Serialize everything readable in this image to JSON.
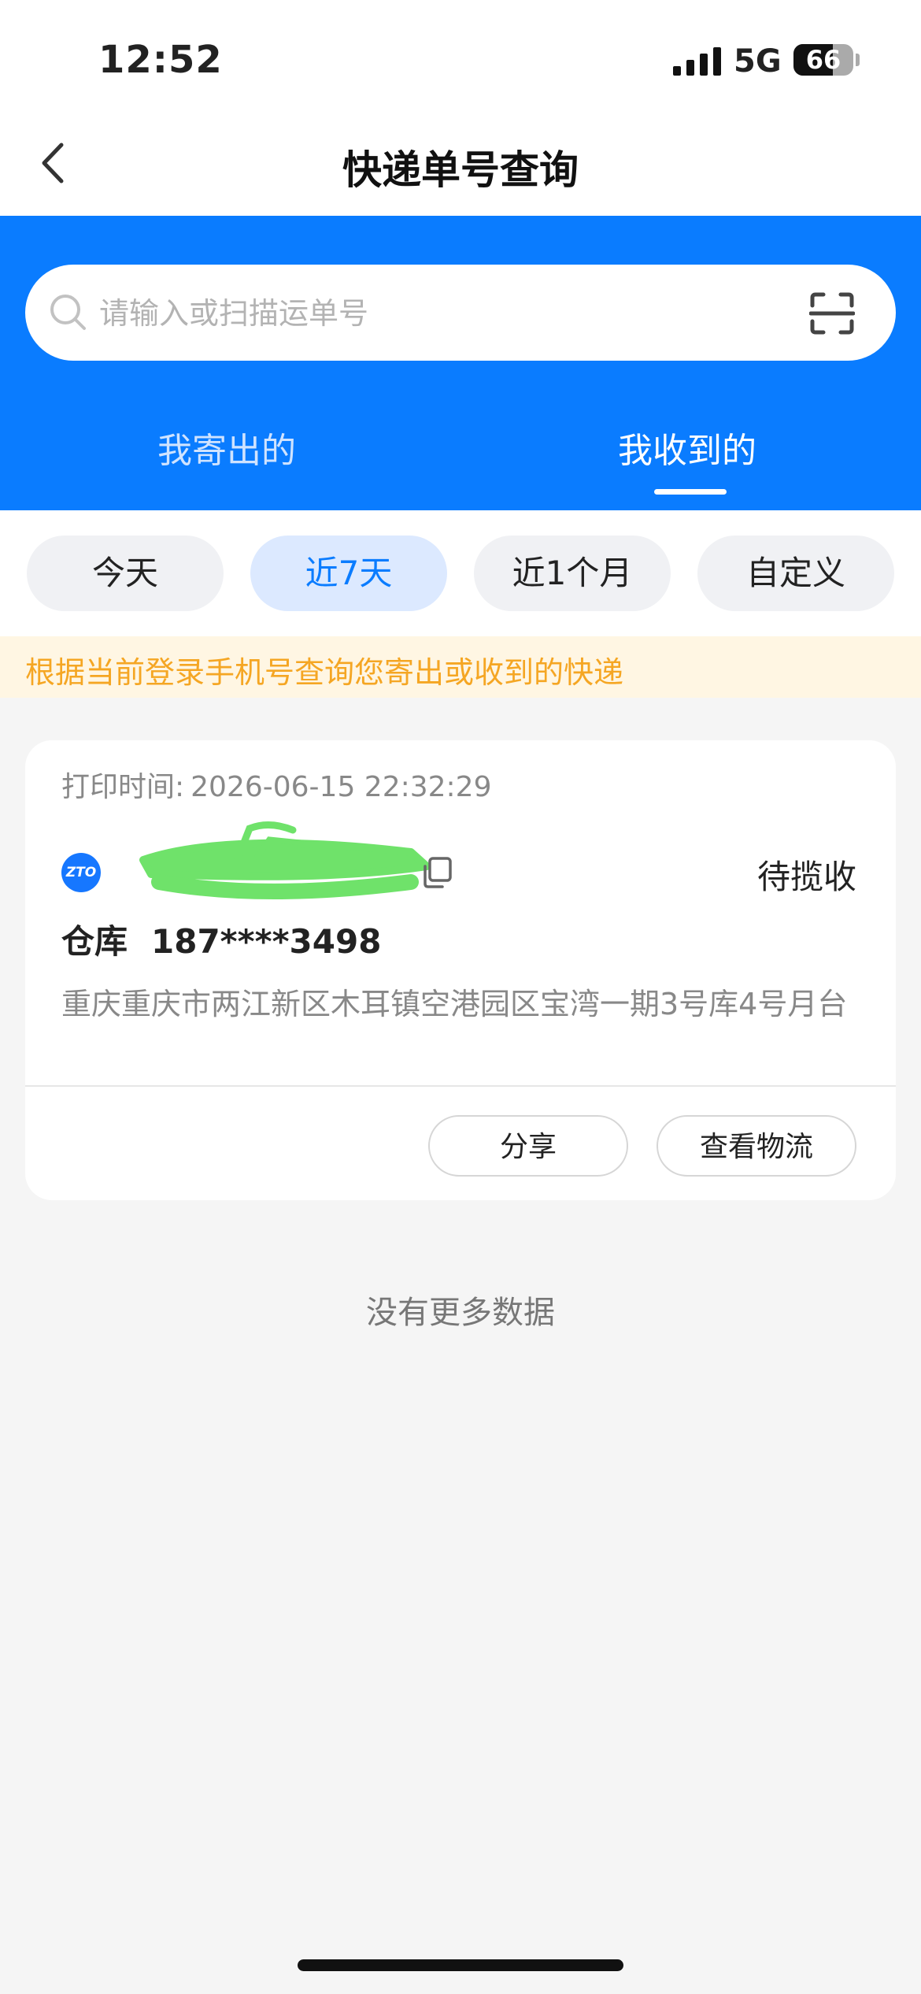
{
  "status_bar": {
    "time": "12:52",
    "network": "5G",
    "battery": "66",
    "battery_level": 0.66
  },
  "nav": {
    "title": "快递单号查询",
    "back_icon": "chevron-left-icon"
  },
  "search": {
    "placeholder": "请输入或扫描运单号",
    "search_icon": "search-icon",
    "scan_icon": "scan-icon"
  },
  "tabs": [
    {
      "label": "我寄出的",
      "active": false
    },
    {
      "label": "我收到的",
      "active": true
    }
  ],
  "filters": [
    {
      "label": "今天",
      "active": false
    },
    {
      "label": "近7天",
      "active": true
    },
    {
      "label": "近1个月",
      "active": false
    },
    {
      "label": "自定义",
      "active": false
    }
  ],
  "notice": "根据当前登录手机号查询您寄出或收到的快递",
  "card": {
    "print_label": "打印时间:",
    "print_time": "2026-06-15 22:32:29",
    "carrier_logo_text": "ZTO",
    "status": "待揽收",
    "receiver_name": "仓库",
    "receiver_phone": "187****3498",
    "address": "重庆重庆市两江新区木耳镇空港园区宝湾一期3号库4号月台",
    "share_label": "分享",
    "track_label": "查看物流"
  },
  "footer_text": "没有更多数据",
  "colors": {
    "primary": "#0a7cff",
    "notice_text": "#f5a623",
    "notice_bg": "#fff6e3",
    "page_bg": "#f5f5f5"
  }
}
